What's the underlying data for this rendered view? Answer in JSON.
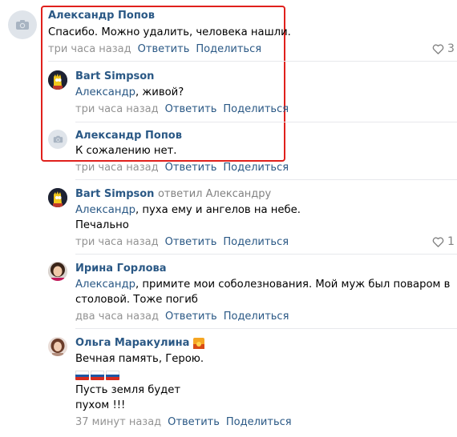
{
  "comments": [
    {
      "author": "Александр Попов",
      "text": "Спасибо. Можно удалить, человека нашли.",
      "time": "три часа назад",
      "reply": "Ответить",
      "share": "Поделиться",
      "likes": "3",
      "avatar": "camera-icon"
    },
    {
      "author": "Bart Simpson",
      "mention": "Александр",
      "text": ", живой?",
      "time": "три часа назад",
      "reply": "Ответить",
      "share": "Поделиться",
      "avatar": "bart-avatar"
    },
    {
      "author": "Александр Попов",
      "text": "К сожалению нет.",
      "time": "три часа назад",
      "reply": "Ответить",
      "share": "Поделиться",
      "avatar": "camera-icon"
    },
    {
      "author": "Bart Simpson",
      "replied_to": "ответил Александру",
      "mention": "Александр",
      "text": ", пуха ему и ангелов на небе.",
      "text2": "Печально",
      "time": "три часа назад",
      "reply": "Ответить",
      "share": "Поделиться",
      "likes": "1",
      "avatar": "bart-avatar"
    },
    {
      "author": "Ирина Горлова",
      "mention": "Александр",
      "text": ", примите мои соболезнования. Мой муж был поваром в",
      "text2": "столовой. Тоже погиб",
      "time": "два часа назад",
      "reply": "Ответить",
      "share": "Поделиться",
      "avatar": "irina-avatar"
    },
    {
      "author": "Ольга Маракулина",
      "text": "Вечная память, Герою.",
      "text3": "Пусть земля будет",
      "text4": "пухом !!!",
      "time": "37 минут назад",
      "reply": "Ответить",
      "share": "Поделиться",
      "avatar": "olga-avatar",
      "flags": [
        "russia-flag",
        "russia-flag",
        "russia-flag"
      ]
    }
  ],
  "colors": {
    "link": "#2a5885",
    "meta": "#939393",
    "highlight_border": "#e0201c",
    "separator": "#e7e8ec"
  }
}
